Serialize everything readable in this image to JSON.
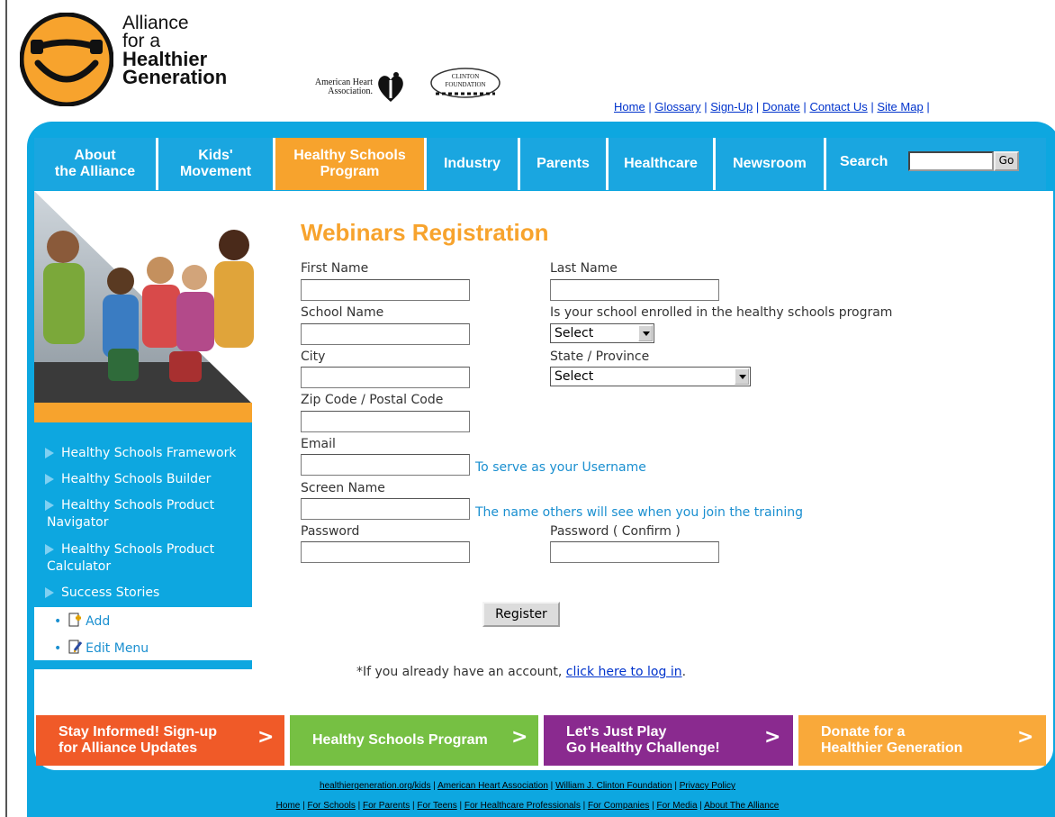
{
  "header": {
    "logo_lines": [
      "Alliance",
      "for a",
      "Healthier",
      "Generation"
    ],
    "aha_text": "American Heart Association.",
    "clinton_text": "CLINTON FOUNDATION",
    "top_links": [
      "Home",
      "Glossary",
      "Sign-Up",
      "Donate",
      "Contact Us",
      "Site Map"
    ]
  },
  "nav": {
    "items": [
      {
        "line1": "About",
        "line2": "the Alliance"
      },
      {
        "line1": "Kids'",
        "line2": "Movement"
      },
      {
        "line1": "Healthy Schools",
        "line2": "Program"
      },
      {
        "line1": "Industry",
        "line2": ""
      },
      {
        "line1": "Parents",
        "line2": ""
      },
      {
        "line1": "Healthcare",
        "line2": ""
      },
      {
        "line1": "Newsroom",
        "line2": ""
      }
    ],
    "search_label": "Search",
    "search_value": "",
    "go_label": "Go"
  },
  "sidebar": {
    "items": [
      "Healthy Schools Framework",
      "Healthy Schools Builder",
      "Healthy Schools Product",
      "Navigator",
      "Healthy Schools Product",
      "Calculator",
      "Success Stories"
    ],
    "edit_items": [
      "Add",
      "Edit Menu"
    ]
  },
  "form": {
    "title": "Webinars Registration",
    "first_name_label": "First Name",
    "last_name_label": "Last Name",
    "school_name_label": "School Name",
    "enrolled_label": "Is your school enrolled in the healthy schools program",
    "enrolled_value": "Select",
    "city_label": "City",
    "state_label": "State / Province",
    "state_value": "Select",
    "zip_label": "Zip Code / Postal Code",
    "email_label": "Email",
    "email_hint": "To serve as your Username",
    "screen_name_label": "Screen Name",
    "screen_name_hint": "The name others will see when you join the training",
    "password_label": "Password",
    "password_confirm_label": "Password ( Confirm )",
    "register_label": "Register",
    "already_text": "*If you already have an account, ",
    "login_link": "click here to log in",
    "already_end": "."
  },
  "promos": [
    {
      "line1": "Stay Informed!  Sign-up",
      "line2": "for Alliance Updates",
      "color": "#f05a28"
    },
    {
      "line1": "Healthy Schools Program",
      "line2": "",
      "color": "#76c043"
    },
    {
      "line1": "Let's Just Play",
      "line2": "Go Healthy Challenge!",
      "color": "#8a2a8f"
    },
    {
      "line1": "Donate for a",
      "line2": "Healthier Generation",
      "color": "#f9a93a"
    }
  ],
  "footer": {
    "row1": [
      "healthiergeneration.org/kids",
      "American Heart Association",
      "William J. Clinton Foundation",
      "Privacy Policy"
    ],
    "row2": [
      "Home",
      "For Schools",
      "For Parents",
      "For Teens",
      "For Healthcare Professionals",
      "For Companies",
      "For Media",
      "About The Alliance"
    ]
  },
  "colors": {
    "brand_blue": "#0da7e0",
    "brand_orange": "#f7a32d",
    "link_blue": "#0033cc"
  }
}
